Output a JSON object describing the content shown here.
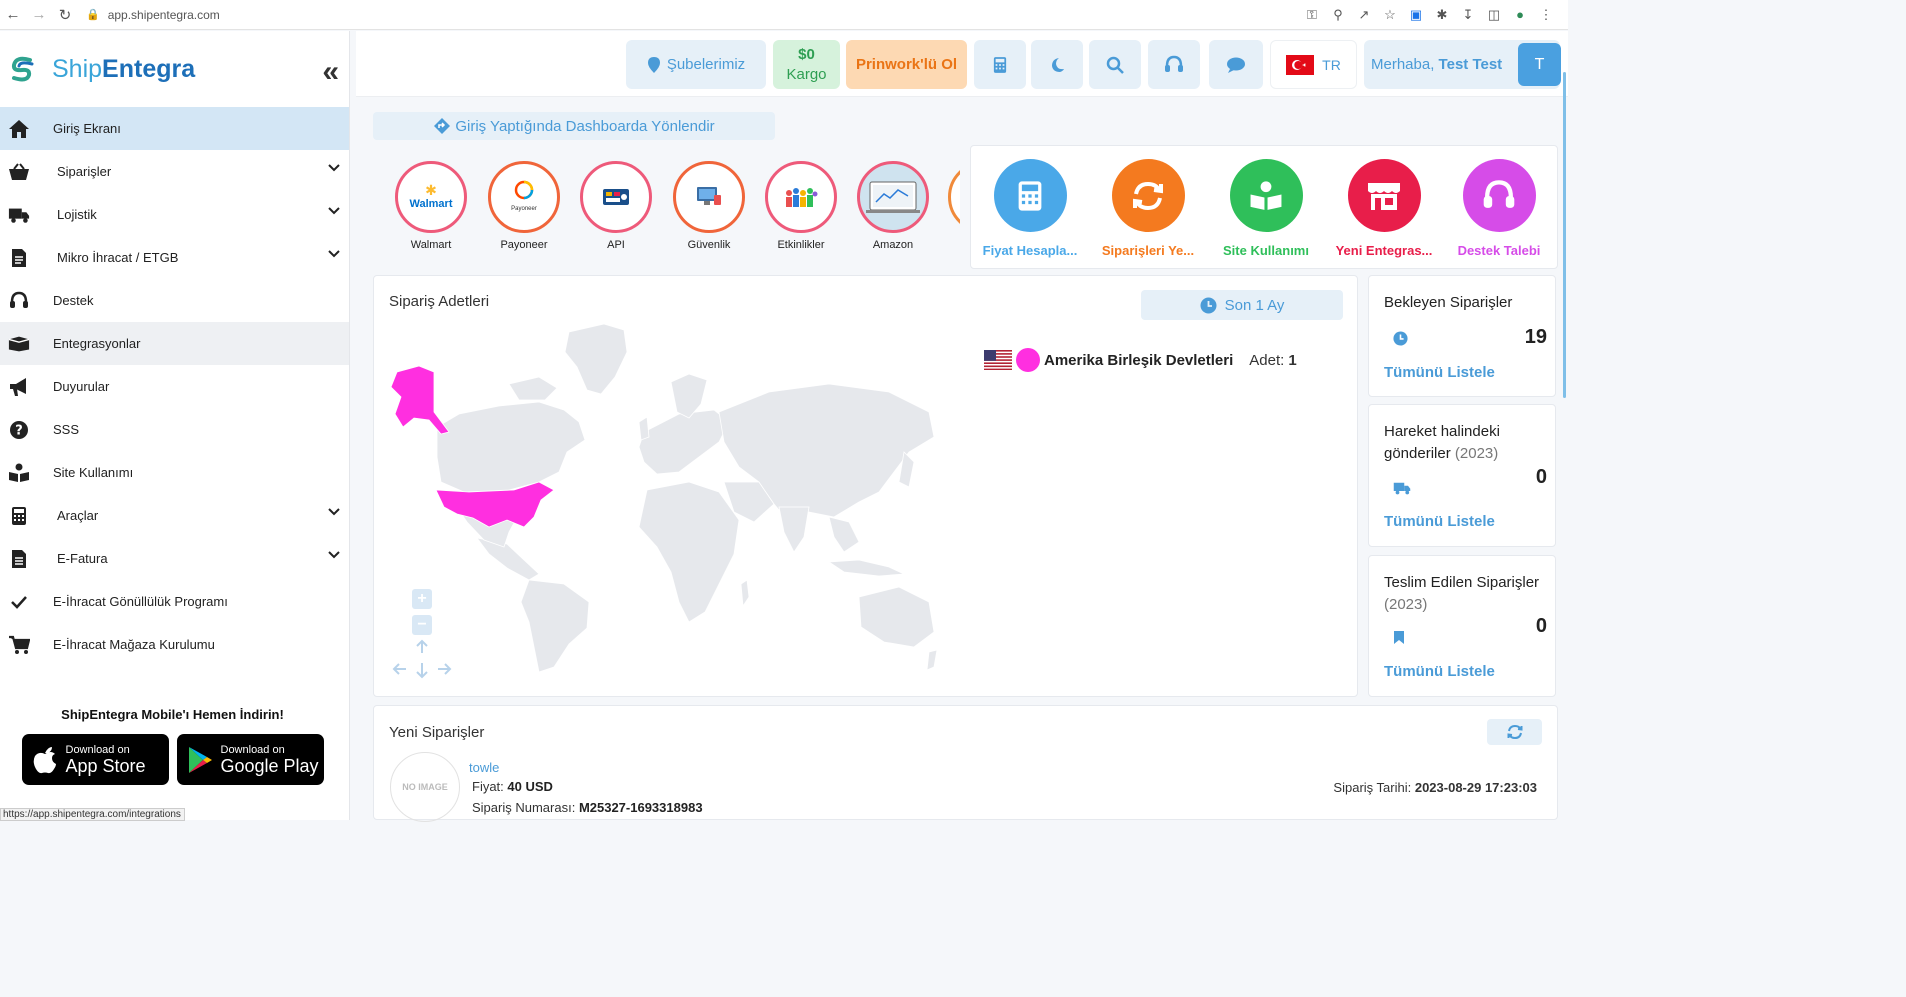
{
  "browser": {
    "url": "app.shipentegra.com",
    "status_url": "https://app.shipentegra.com/integrations"
  },
  "sidebar": {
    "logo_part1": "Ship",
    "logo_part2": "Entegra",
    "items": [
      {
        "label": "Giriş Ekranı",
        "icon": "home-icon"
      },
      {
        "label": "Siparişler",
        "icon": "basket-icon"
      },
      {
        "label": "Lojistik",
        "icon": "truck-icon"
      },
      {
        "label": "Mikro İhracat / ETGB",
        "icon": "document-icon"
      },
      {
        "label": "Destek",
        "icon": "headset-icon"
      },
      {
        "label": "Entegrasyonlar",
        "icon": "box-icon"
      },
      {
        "label": "Duyurular",
        "icon": "megaphone-icon"
      },
      {
        "label": "SSS",
        "icon": "question-icon"
      },
      {
        "label": "Site Kullanımı",
        "icon": "reader-icon"
      },
      {
        "label": "Araçlar",
        "icon": "calculator-icon"
      },
      {
        "label": "E-Fatura",
        "icon": "invoice-icon"
      },
      {
        "label": "E-İhracat Gönüllülük Programı",
        "icon": "check-icon"
      },
      {
        "label": "E-İhracat Mağaza Kurulumu",
        "icon": "cart-icon"
      }
    ],
    "mobile_title": "ShipEntegra Mobile'ı Hemen İndirin!",
    "appstore_small": "Download on",
    "appstore_big": "App Store",
    "googleplay_small": "Download on",
    "googleplay_big": "Google Play"
  },
  "header": {
    "branches": "Şubelerimiz",
    "cargo_amount": "$0",
    "cargo_label": "Kargo",
    "prinwork": "Prinwork'lü Ol",
    "lang": "TR",
    "greeting": "Merhaba,",
    "user_name": "Test Test",
    "avatar_letter": "T"
  },
  "redirect_text": "Giriş Yaptığında Dashboarda Yönlendir",
  "integrations": [
    {
      "label": "Walmart",
      "logo_text": "Walmart"
    },
    {
      "label": "Payoneer",
      "logo_text": "Payoneer"
    },
    {
      "label": "API",
      "logo_text": ""
    },
    {
      "label": "Güvenlik",
      "logo_text": ""
    },
    {
      "label": "Etkinlikler",
      "logo_text": ""
    },
    {
      "label": "Amazon",
      "logo_text": ""
    }
  ],
  "quick_actions": [
    {
      "label": "Fiyat Hesapla...",
      "color": "#4aa8e8",
      "icon": "calculator-icon"
    },
    {
      "label": "Siparişleri Ye...",
      "color": "#f47a1f",
      "icon": "sync-icon"
    },
    {
      "label": "Site Kullanımı",
      "color": "#2fbf5a",
      "icon": "reader-icon"
    },
    {
      "label": "Yeni Entegras...",
      "color": "#e81e4a",
      "icon": "store-icon"
    },
    {
      "label": "Destek Talebi",
      "color": "#d64ce8",
      "icon": "headset-icon"
    }
  ],
  "order_map": {
    "title": "Sipariş Adetleri",
    "period": "Son 1 Ay",
    "country": "Amerika Birleşik Devletleri",
    "count_label": "Adet:",
    "count": "1",
    "highlight_color": "#ff2fe0"
  },
  "stats": [
    {
      "title": "Bekleyen Siparişler",
      "year": "",
      "value": "19",
      "link": "Tümünü Listele",
      "icon": "clock-icon"
    },
    {
      "title": "Hareket halindeki gönderiler",
      "year": "(2023)",
      "value": "0",
      "link": "Tümünü Listele",
      "icon": "truck-icon"
    },
    {
      "title": "Teslim Edilen Siparişler",
      "year": "(2023)",
      "value": "0",
      "link": "Tümünü Listele",
      "icon": "bookmark-icon"
    }
  ],
  "new_orders": {
    "title": "Yeni Siparişler",
    "no_image": "NO IMAGE",
    "product": "towle",
    "price_label": "Fiyat:",
    "price": "40 USD",
    "order_no_label": "Sipariş Numarası:",
    "order_no": "M25327-1693318983",
    "date_label": "Sipariş Tarihi:",
    "date": "2023-08-29 17:23:03"
  }
}
